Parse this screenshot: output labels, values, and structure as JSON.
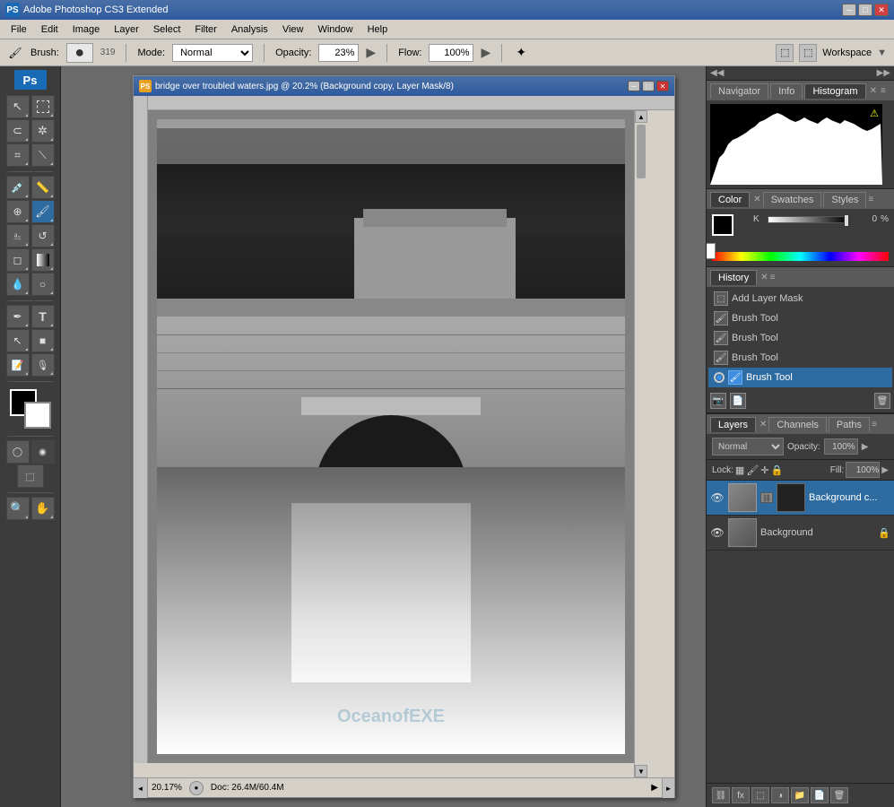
{
  "app": {
    "title": "Adobe Photoshop CS3 Extended",
    "icon": "PS"
  },
  "titlebar": {
    "title": "Adobe Photoshop CS3 Extended",
    "min_label": "─",
    "max_label": "□",
    "close_label": "✕"
  },
  "menubar": {
    "items": [
      "File",
      "Edit",
      "Image",
      "Layer",
      "Select",
      "Filter",
      "Analysis",
      "View",
      "Window",
      "Help"
    ]
  },
  "optionsbar": {
    "brush_label": "Brush:",
    "brush_size": "319",
    "mode_label": "Mode:",
    "mode_value": "Normal",
    "opacity_label": "Opacity:",
    "opacity_value": "23%",
    "flow_label": "Flow:",
    "flow_value": "100%",
    "workspace_label": "Workspace"
  },
  "document": {
    "title": "bridge over troubled waters.jpg @ 20.2% (Background copy, Layer Mask/8)",
    "zoom": "20.17%",
    "fileinfo": "Doc: 26.4M/60.4M",
    "watermark": "OceanofEXE"
  },
  "panels": {
    "navigator_tab": "Navigator",
    "info_tab": "Info",
    "histogram_tab": "Histogram",
    "color_tab": "Color",
    "swatches_tab": "Swatches",
    "styles_tab": "Styles",
    "history_tab": "History",
    "layers_tab": "Layers",
    "channels_tab": "Channels",
    "paths_tab": "Paths"
  },
  "color_panel": {
    "k_label": "K",
    "k_value": "0",
    "percent": "%"
  },
  "history": {
    "items": [
      {
        "label": "Add Layer Mask",
        "type": "mask"
      },
      {
        "label": "Brush Tool",
        "type": "brush"
      },
      {
        "label": "Brush Tool",
        "type": "brush"
      },
      {
        "label": "Brush Tool",
        "type": "brush"
      },
      {
        "label": "Brush Tool",
        "type": "brush",
        "active": true
      }
    ]
  },
  "layers": {
    "blend_mode": "Normal",
    "opacity_label": "Opacity:",
    "opacity_value": "100%",
    "lock_label": "Lock:",
    "fill_label": "Fill:",
    "fill_value": "100%",
    "items": [
      {
        "name": "Background c...",
        "active": true,
        "has_mask": true
      },
      {
        "name": "Background",
        "active": false,
        "locked": true
      }
    ]
  },
  "tools": {
    "items": [
      {
        "icon": "↖",
        "label": "move-tool"
      },
      {
        "icon": "⬚",
        "label": "marquee-tool"
      },
      {
        "icon": "✂",
        "label": "lasso-tool"
      },
      {
        "icon": "⊕",
        "label": "magic-wand"
      },
      {
        "icon": "✄",
        "label": "crop-tool"
      },
      {
        "icon": "⊘",
        "label": "slice-tool"
      },
      {
        "icon": "🔬",
        "label": "eyedropper"
      },
      {
        "icon": "⌖",
        "label": "spot-heal"
      },
      {
        "icon": "🖌",
        "label": "brush-tool"
      },
      {
        "icon": "▣",
        "label": "clone-stamp"
      },
      {
        "icon": "🕰",
        "label": "history-brush"
      },
      {
        "icon": "◻",
        "label": "eraser"
      },
      {
        "icon": "▦",
        "label": "gradient"
      },
      {
        "icon": "⬡",
        "label": "dodge-burn"
      },
      {
        "icon": "✒",
        "label": "pen-tool"
      },
      {
        "icon": "T",
        "label": "type-tool"
      },
      {
        "icon": "⬡",
        "label": "shape-tool"
      },
      {
        "icon": "🔍",
        "label": "zoom-tool"
      }
    ]
  }
}
